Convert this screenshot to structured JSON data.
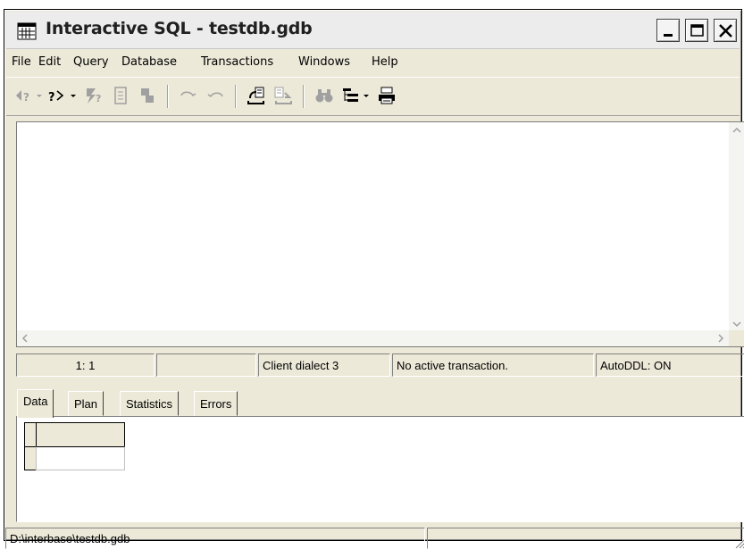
{
  "window": {
    "title": "Interactive SQL - testdb.gdb"
  },
  "menu": [
    "File",
    "Edit",
    "Query",
    "Database",
    "Transactions",
    "Windows",
    "Help"
  ],
  "toolbar": {
    "buttons": [
      "prev-query-icon",
      "next-query-icon",
      "execute-icon",
      "commit-icon",
      "rollback-icon",
      "undo-icon",
      "redo-icon",
      "load-script-icon",
      "save-script-icon",
      "find-icon",
      "options-icon",
      "print-icon"
    ]
  },
  "status": {
    "position": "1:  1",
    "empty": "",
    "dialect": "Client dialect 3",
    "transaction": "No active transaction.",
    "autoddl": "AutoDDL: ON"
  },
  "tabs": [
    "Data",
    "Plan",
    "Statistics",
    "Errors"
  ],
  "footer": {
    "path": "D:\\interbase\\testdb.gdb"
  }
}
